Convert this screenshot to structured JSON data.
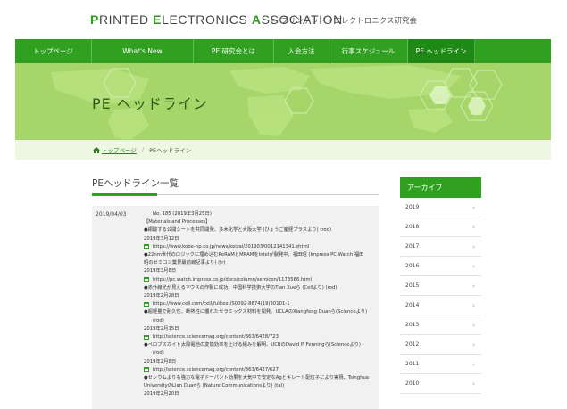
{
  "header": {
    "logo_parts": [
      {
        "cap": "P",
        "rest": "RINTED "
      },
      {
        "cap": "E",
        "rest": "LECTRONICS "
      },
      {
        "cap": "A",
        "rest": "SSOCIATION"
      }
    ],
    "logo_subtitle": "— プリンテッド・エレクトロニクス研究会"
  },
  "nav": {
    "items": [
      {
        "label": "トップページ"
      },
      {
        "label": "What's New"
      },
      {
        "label": "PE 研究会とは"
      },
      {
        "label": "入会方法"
      },
      {
        "label": "行事スケジュール"
      },
      {
        "label": "PE ヘッドライン"
      }
    ]
  },
  "hero": {
    "title": "PE ヘッドライン"
  },
  "breadcrumb": {
    "home": "トップページ",
    "current": "PEヘッドライン"
  },
  "main": {
    "heading": "PEヘッドライン一覧",
    "entry_date": "2019/04/03",
    "lines": [
      {
        "type": "text",
        "text": "No. 185 (2019年3月25日)",
        "indent": true
      },
      {
        "type": "text",
        "text": "【Materials and Processes】"
      },
      {
        "type": "text",
        "text": "●銅酸する公開シートを共同開発、多木化学と大阪大学 (ひょうご産経プラスより)  (rod)"
      },
      {
        "type": "text",
        "text": "2019年3月12日"
      },
      {
        "type": "link",
        "text": "https://www.kobe-np.co.jp/news/keizai/201903/0012141341.shtml"
      },
      {
        "type": "text",
        "text": "●22nm世代のロジックに埋め込むReRAMとMRAMをIntelが製発中、福田昭 (Impress PC Watch 福田"
      },
      {
        "type": "text",
        "text": "昭のセミコン業界最前線記事より)  (tr)"
      },
      {
        "type": "text",
        "text": "2019年3月8日"
      },
      {
        "type": "link",
        "text": "https://pc.watch.impress.co.jp/docs/column/semicon/1173566.html"
      },
      {
        "type": "text",
        "text": "●赤外線光が見えるマウスの作製に成功、中国科学技術大学のTian Xueら (Cellより)  (rod)"
      },
      {
        "type": "text",
        "text": "2019年2月28日"
      },
      {
        "type": "link",
        "text": "https://www.cell.com/cell/fulltext/S0092-8674(19)30101-1"
      },
      {
        "type": "text",
        "text": "●超軽量で耐久性、断熱性に優れたセラミックス材料を開発、UCLAのXiangfeng Duanら(Scienceより)"
      },
      {
        "type": "text",
        "text": "(rod)",
        "indent": true
      },
      {
        "type": "text",
        "text": "2019年2月15日"
      },
      {
        "type": "link",
        "text": "http://science.sciencemag.org/content/363/6428/723"
      },
      {
        "type": "text",
        "text": "●ペロブスカイト太陽電池の変換効率を上げる組みを解明、UCBのDavid P. Fenningら(Scienceより)"
      },
      {
        "type": "text",
        "text": "(rod)",
        "indent": true
      },
      {
        "type": "text",
        "text": "2019年2月8日"
      },
      {
        "type": "link",
        "text": "http://science.sciencemag.org/content/363/6427/627"
      },
      {
        "type": "text",
        "text": "●セシウムよりも強力な電子ドーパント効果を大気中で安定なAgとキレート配位子により実現、Tsinghua"
      },
      {
        "type": "text",
        "text": "UniversityのLian Duanら (Nature Communicationsより)  (tal)"
      },
      {
        "type": "text",
        "text": "2019年2月20日"
      }
    ]
  },
  "sidebar": {
    "archive_title": "アーカイブ",
    "years": [
      "2019",
      "2018",
      "2017",
      "2016",
      "2015",
      "2014",
      "2013",
      "2012",
      "2011",
      "2010"
    ]
  }
}
